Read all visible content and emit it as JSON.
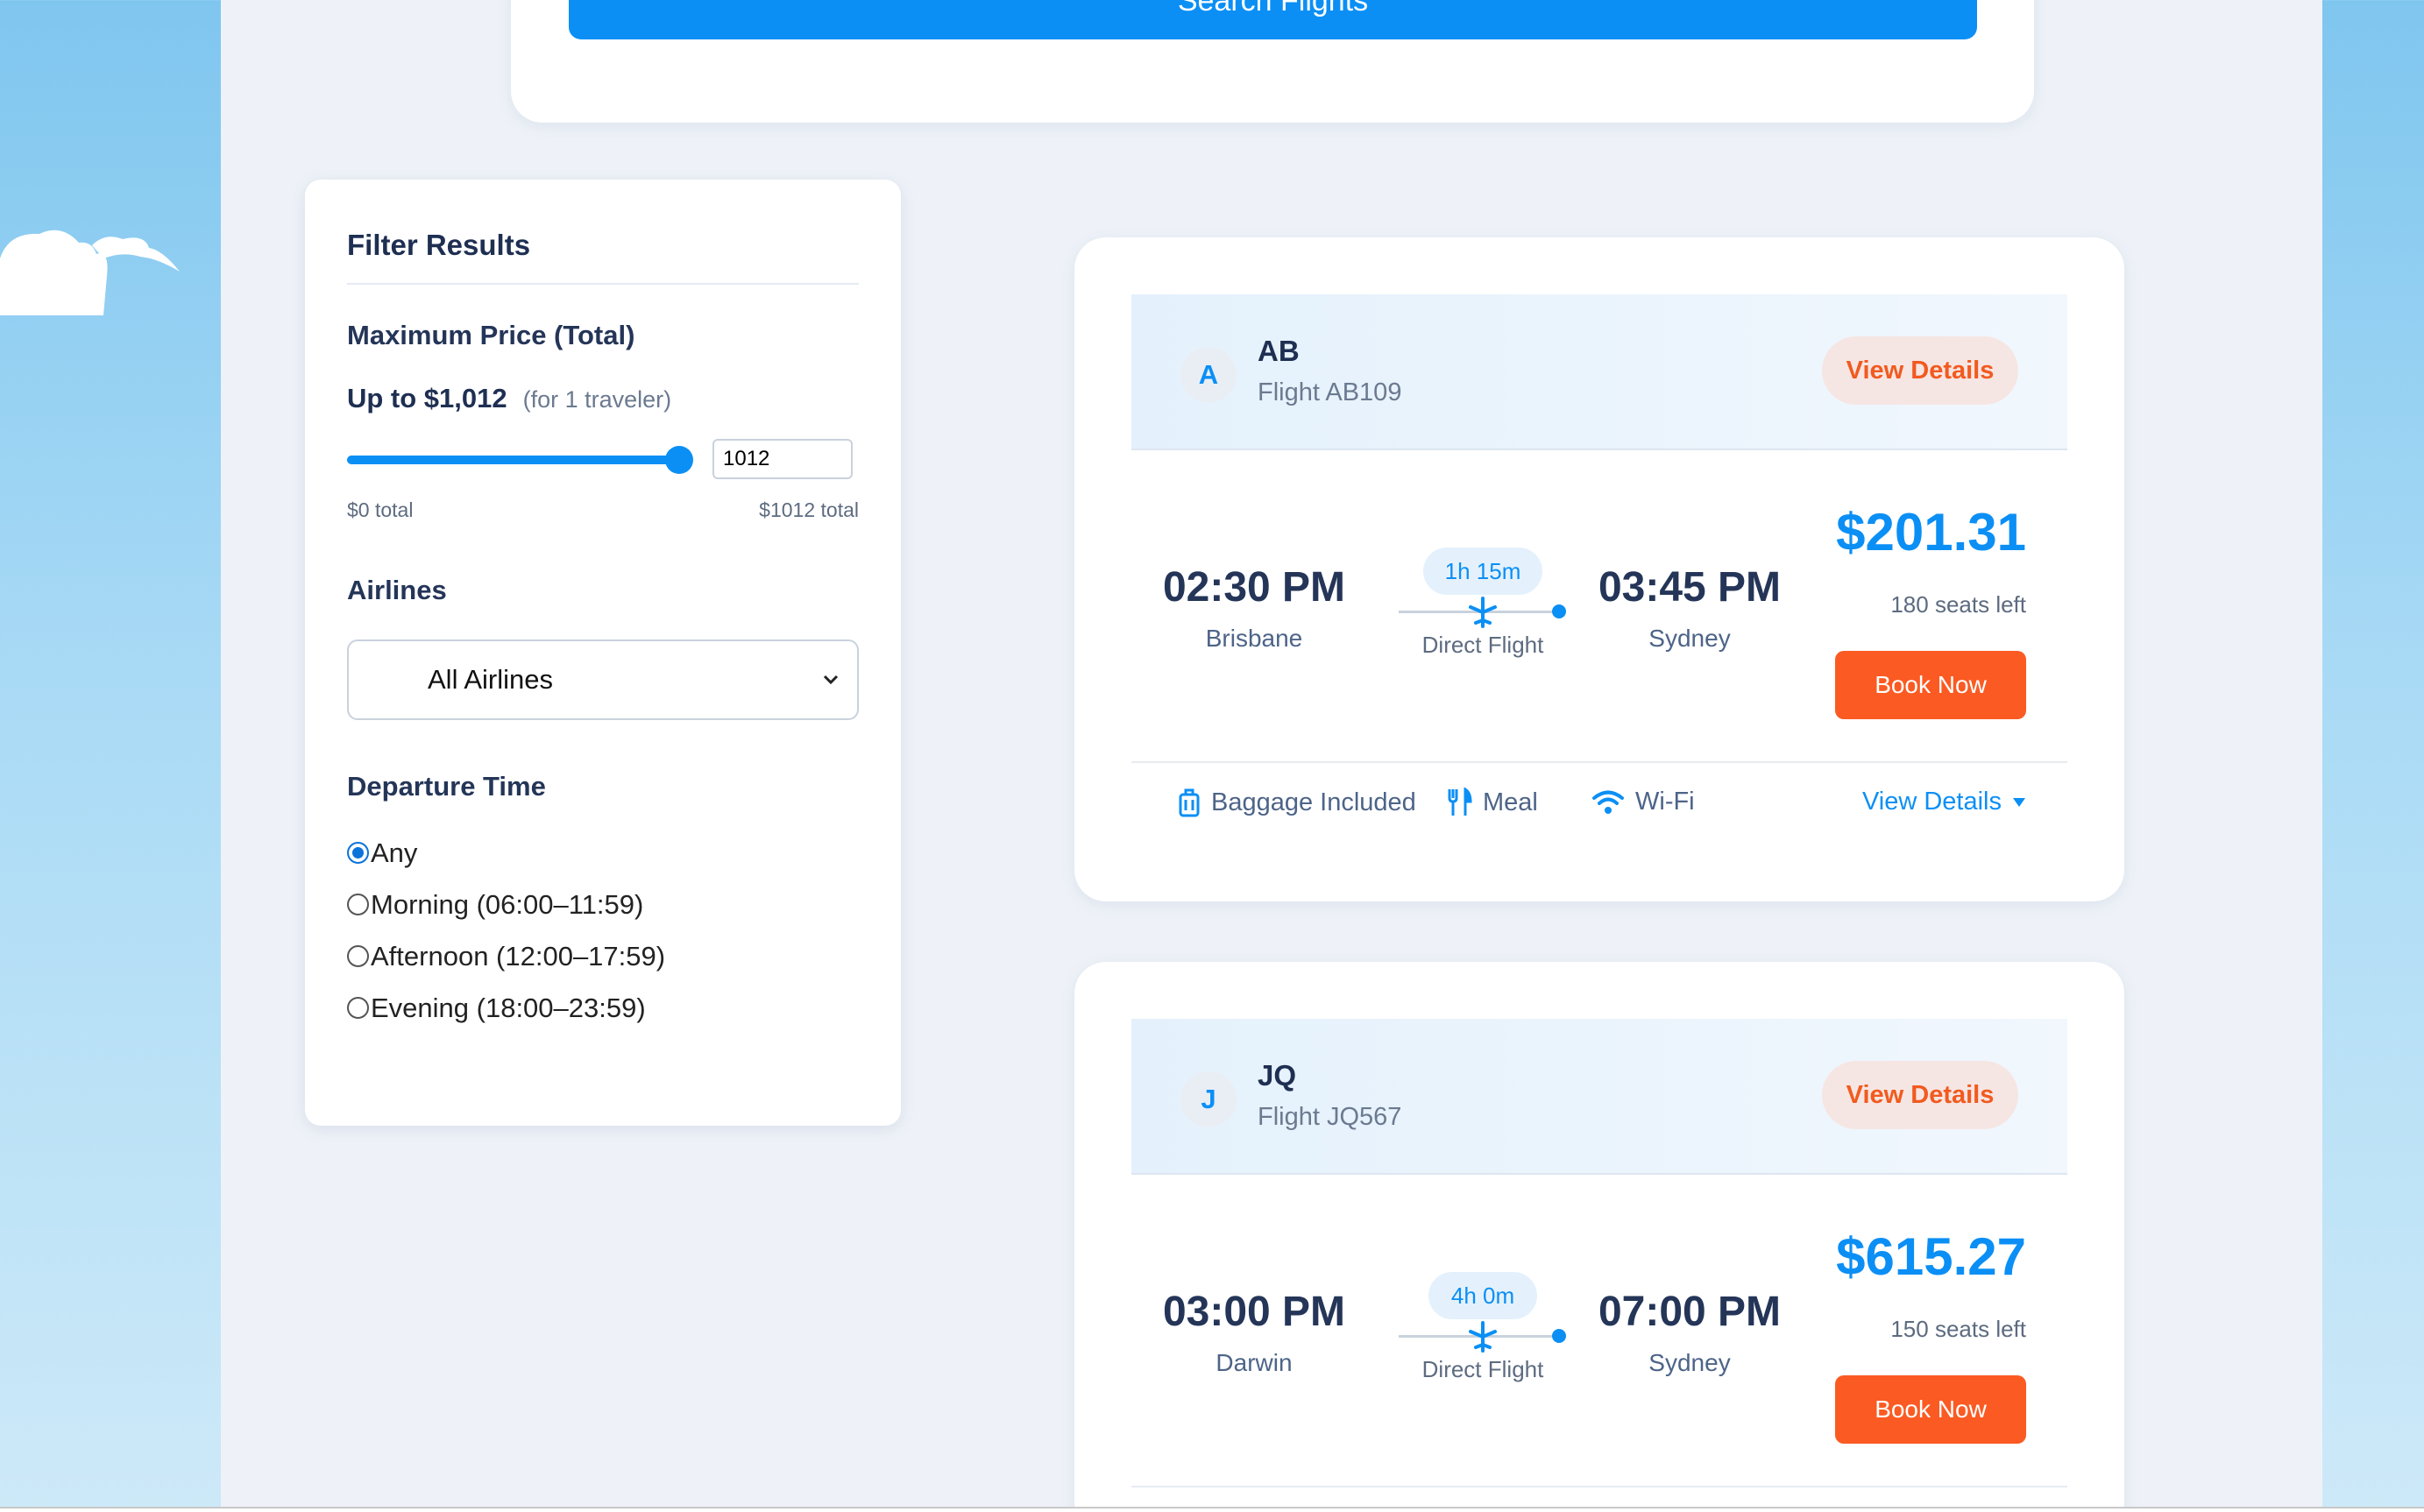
{
  "search": {
    "button_label": "Search Flights"
  },
  "filter": {
    "title": "Filter Results",
    "price": {
      "section_title": "Maximum Price (Total)",
      "amount_label": "Up to $1,012",
      "travelers_label": "(for 1 traveler)",
      "input_value": "1012",
      "min_label": "$0 total",
      "max_label": "$1012 total",
      "slider_fraction": 1.0
    },
    "airlines": {
      "section_title": "Airlines",
      "selected": "All Airlines"
    },
    "departure": {
      "section_title": "Departure Time",
      "options": [
        "Any",
        "Morning (06:00–11:59)",
        "Afternoon (12:00–17:59)",
        "Evening (18:00–23:59)"
      ],
      "selected_index": 0
    }
  },
  "flights": [
    {
      "avatar_letter": "A",
      "airline_code": "AB",
      "flight_number": "Flight AB109",
      "details_label": "View Details",
      "depart_time": "02:30 PM",
      "depart_city": "Brisbane",
      "arrive_time": "03:45 PM",
      "arrive_city": "Sydney",
      "duration": "1h 15m",
      "stops_label": "Direct Flight",
      "price": "$201.31",
      "seats": "180 seats left",
      "book_label": "Book Now",
      "amenities": [
        "Baggage Included",
        "Meal",
        "Wi-Fi"
      ],
      "expand_label": "View Details"
    },
    {
      "avatar_letter": "J",
      "airline_code": "JQ",
      "flight_number": "Flight JQ567",
      "details_label": "View Details",
      "depart_time": "03:00 PM",
      "depart_city": "Darwin",
      "arrive_time": "07:00 PM",
      "arrive_city": "Sydney",
      "duration": "4h 0m",
      "stops_label": "Direct Flight",
      "price": "$615.27",
      "seats": "150 seats left",
      "book_label": "Book Now"
    }
  ],
  "colors": {
    "accent": "#0b8ff5",
    "cta": "#fb5a22",
    "heading": "#1e2f52"
  },
  "icons": [
    "cloud-icon",
    "plane-icon",
    "luggage-icon",
    "utensils-icon",
    "wifi-icon",
    "chevron-down-icon"
  ]
}
